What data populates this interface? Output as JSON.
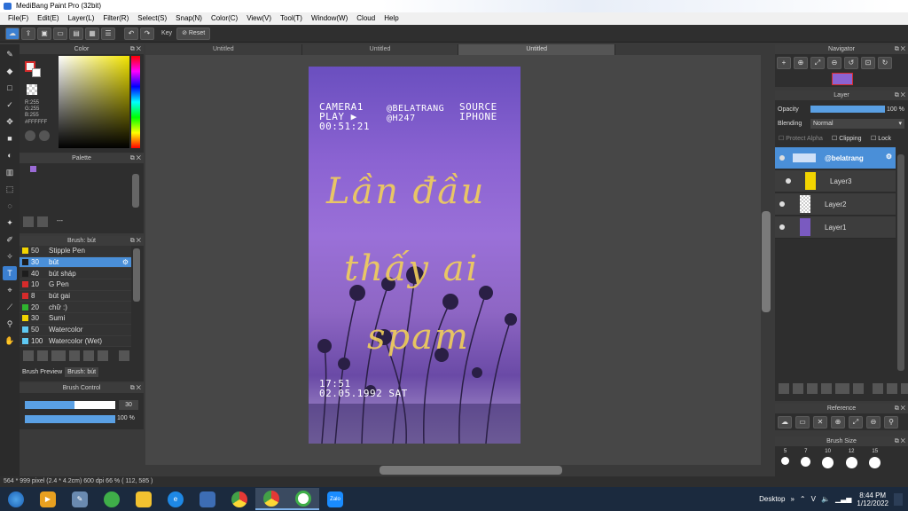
{
  "window": {
    "title": "MediBang Paint Pro (32bit)"
  },
  "menu": [
    "File(F)",
    "Edit(E)",
    "Layer(L)",
    "Filter(R)",
    "Select(S)",
    "Snap(N)",
    "Color(C)",
    "View(V)",
    "Tool(T)",
    "Window(W)",
    "Cloud",
    "Help"
  ],
  "toolbar": {
    "key_label": "Key",
    "reset_label": "Reset"
  },
  "tabs": [
    "Untitled",
    "Untitled",
    "Untitled"
  ],
  "color_panel": {
    "title": "Color",
    "r": "R:255",
    "g": "G:255",
    "b": "B:255",
    "hex": "#FFFFFF"
  },
  "palette_panel": {
    "title": "Palette",
    "footer": "---"
  },
  "brush_panel": {
    "title": "Brush: bút",
    "items": [
      {
        "size": "50",
        "name": "Stipple Pen",
        "color": "#f2d400"
      },
      {
        "size": "30",
        "name": "bút",
        "color": "#1d1d1d"
      },
      {
        "size": "40",
        "name": "bút sháp",
        "color": "#1d1d1d"
      },
      {
        "size": "10",
        "name": "G Pen",
        "color": "#d62b2b"
      },
      {
        "size": "8",
        "name": "bút gai",
        "color": "#d62b2b"
      },
      {
        "size": "20",
        "name": "chữ :)",
        "color": "#2fb42f"
      },
      {
        "size": "30",
        "name": "Sumi",
        "color": "#f2d400"
      },
      {
        "size": "50",
        "name": "Watercolor",
        "color": "#5ec8f2"
      },
      {
        "size": "100",
        "name": "Watercolor (Wet)",
        "color": "#5ec8f2"
      }
    ],
    "tab_preview": "Brush Preview",
    "tab_brush": "Brush: bút"
  },
  "brush_control": {
    "title": "Brush Control",
    "size_value": "30",
    "opacity_value": "100 %",
    "size_fraction": 0.55,
    "opacity_fraction": 1.0
  },
  "artwork": {
    "cam_line1": "CAMERA1",
    "cam_line2": "PLAY ▶",
    "cam_line3": "00:51:21",
    "handle1": "@BELATRANG",
    "handle2": "@H247",
    "source1": "SOURCE",
    "source2": "IPHONE",
    "script1": "Lần đầu",
    "script2": "thấy ai",
    "script3": "spam",
    "time": "17:51",
    "date": "02.05.1992 SAT"
  },
  "navigator": {
    "title": "Navigator"
  },
  "layer_panel": {
    "title": "Layer",
    "opacity_label": "Opacity",
    "opacity_value": "100 %",
    "opacity_fraction": 1.0,
    "blending_label": "Blending",
    "blending_value": "Normal",
    "protect_alpha": "Protect Alpha",
    "clipping": "Clipping",
    "lock": "Lock",
    "layers": [
      {
        "name": "@belatrang",
        "selected": true
      },
      {
        "name": "Layer3",
        "selected": false
      },
      {
        "name": "Layer2",
        "selected": false
      },
      {
        "name": "Layer1",
        "selected": false
      }
    ]
  },
  "reference_panel": {
    "title": "Reference"
  },
  "brush_size_panel": {
    "title": "Brush Size",
    "sizes": [
      "5",
      "7",
      "10",
      "12",
      "15"
    ]
  },
  "status": {
    "text": "564 * 999 pixel  (2.4 * 4.2cm)  600 dpi  66 %  ( 112, 585 )"
  },
  "taskbar": {
    "desktop_label": "Desktop",
    "time": "8:44 PM",
    "date": "1/12/2022",
    "lang": "V"
  }
}
